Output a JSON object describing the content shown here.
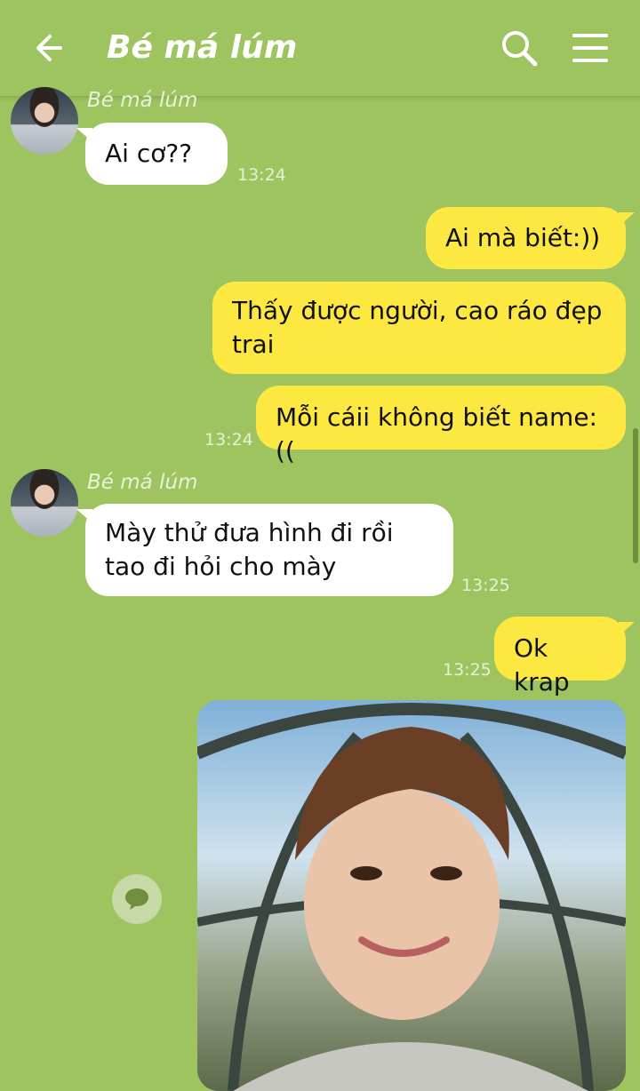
{
  "header": {
    "title": "Bé má lúm"
  },
  "contact": {
    "name": "Bé má lúm"
  },
  "messages": [
    {
      "dir": "in",
      "text": "Ai cơ??",
      "time": "13:24"
    },
    {
      "dir": "out",
      "text": "Ai mà biết:))"
    },
    {
      "dir": "out",
      "text": "Thấy được người, cao ráo đẹp trai"
    },
    {
      "dir": "out",
      "text": "Mỗi cáii không biết name:((",
      "time": "13:24"
    },
    {
      "dir": "in",
      "text": "Mày thử đưa hình đi rồi tao đi hỏi cho mày",
      "time": "13:25"
    },
    {
      "dir": "out",
      "text": "Ok krap",
      "time": "13:25"
    }
  ],
  "colors": {
    "background": "#9dc45f",
    "outgoing": "#fde841",
    "incoming": "#ffffff"
  }
}
